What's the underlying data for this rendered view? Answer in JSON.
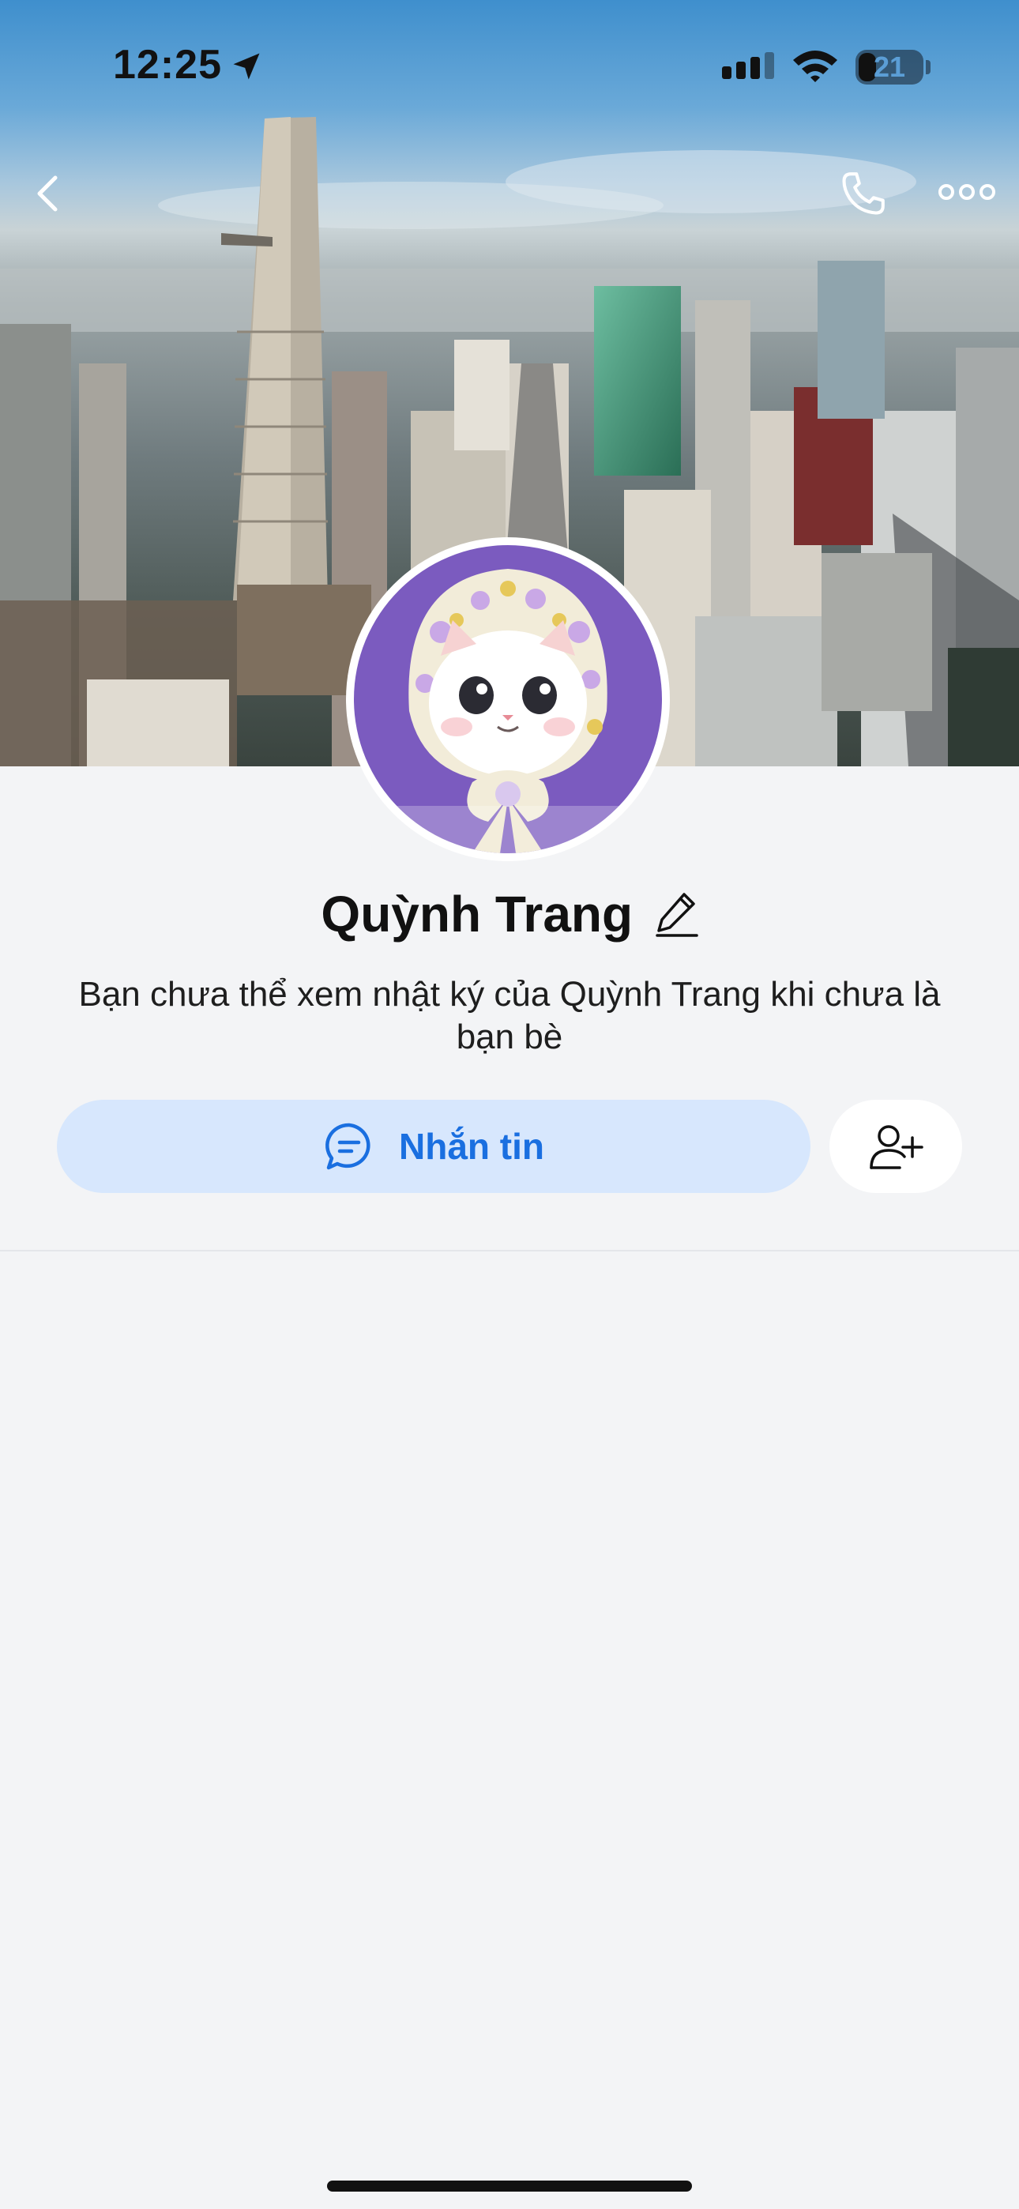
{
  "status_bar": {
    "time": "12:25",
    "battery_level": "21"
  },
  "header": {
    "icons": [
      "back-chevron-icon",
      "phone-icon",
      "more-dots-icon"
    ]
  },
  "profile": {
    "name": "Quỳnh Trang",
    "notice": "Bạn chưa thể xem nhật ký của Quỳnh Trang khi chưa là bạn bè"
  },
  "actions": {
    "message_label": "Nhắn tin",
    "message_icon": "chat-bubble-icon",
    "add_friend_icon": "add-friend-icon"
  },
  "colors": {
    "accent": "#1a6fe0",
    "message_button_bg": "#d7e7fd",
    "page_bg": "#f3f4f6"
  }
}
